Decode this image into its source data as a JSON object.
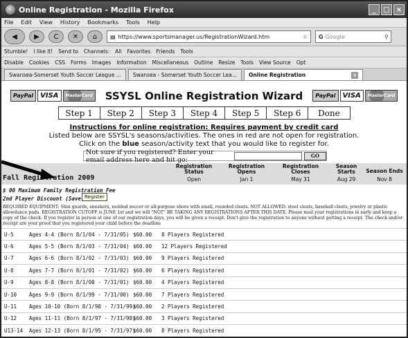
{
  "window": {
    "title": "Online Registration - Mozilla Firefox"
  },
  "menu": [
    "File",
    "Edit",
    "View",
    "History",
    "Bookmarks",
    "Tools",
    "Help"
  ],
  "nav": {
    "url": "https://www.sportsmanager.us/RegistrationWizard.htm",
    "search_placeholder": "Google"
  },
  "toolbar1": [
    "Stumble!",
    "I like it!",
    "Send to",
    "Channels:",
    "All",
    "Favorites",
    "Friends",
    "Tools"
  ],
  "toolbar2": [
    "Disable",
    "Cookies",
    "CSS",
    "Forms",
    "Images",
    "Information",
    "Miscellaneous",
    "Outline",
    "Resize",
    "Tools",
    "View Source",
    "Opt"
  ],
  "tabs": [
    {
      "label": "Swansea-Somerset Youth Soccer League ..."
    },
    {
      "label": "Swansea - Somerset Youth Soccer Lea..."
    },
    {
      "label": "Online Registration"
    }
  ],
  "page": {
    "payments": [
      "PayPal",
      "VISA",
      "MasterCard"
    ],
    "title": "SSYSL Online Registration Wizard",
    "steps": [
      "Step 1",
      "Step 2",
      "Step 3",
      "Step 4",
      "Step 5",
      "Step 6",
      "Done"
    ],
    "instr_heading": "Instructions for online registration: Requires payment by credit card",
    "instr_line2": "Listed below are SSYSL's seasons/activities. The ones in red are not open for registration.",
    "instr_line3_a": "Click on the ",
    "instr_line3_b": "blue",
    "instr_line3_c": " season/activity text that you would like to register for.",
    "email_prompt": "Not sure if you registered? Enter your email address here and hit go:",
    "go": "GO",
    "season": {
      "name": "Fall Registration 2009",
      "col_status": "Registration Status",
      "col_opens": "Registration Opens",
      "col_closes": "Registration Closes",
      "col_starts": "Season Starts",
      "col_ends": "Season Ends",
      "status": "Open",
      "opens": "Jan 1",
      "closes": "May 31",
      "starts": "Aug 29",
      "ends": "Nov 8"
    },
    "fee1": "$ 00 Maximum Family Registration Fee",
    "fee2": "2nd Player Discount (Save $20.00)",
    "tooltip": "Register",
    "equipment": "REQUIRED EQUIPMENT: Shin guards, sneakers, molded soccer or all-purpose shoes with small, rounded cleats. NOT ALLOWED: steel cleats, baseball cleats, jewelry or plastic allowdance pads. REGISTRATION CUTOFF is JUNE 1st and we will \"NOT\" BE TAKING ANY REGISTRATIONS AFTER THIS DATE. Please mail your registrations in early and keep a copy of the check. If you register in person at one of our registration days, you will be given a receipt. Don't give the registration to anyone without getting a receipt. The check and/or receipt are your proof that you registered your child before the deadline",
    "divisions": [
      {
        "div": "U-5",
        "ages": "Ages 4-4 (Born 8/1/04 - 7/31/05)",
        "fee": "$60.00",
        "count": "8 Players Registered"
      },
      {
        "div": "U-6",
        "ages": "Ages 5-5 (Born 8/1/03 - 7/31/04)",
        "fee": "$60.00",
        "count": "12 Players Registered"
      },
      {
        "div": "U-7",
        "ages": "Ages 6-6 (Born 8/1/02 - 7/31/03)",
        "fee": "$60.00",
        "count": "9 Players Registered"
      },
      {
        "div": "U-8",
        "ages": "Ages 7-7 (Born 8/1/01 - 7/31/02)",
        "fee": "$60.00",
        "count": "6 Players Registered"
      },
      {
        "div": "U-9",
        "ages": "Ages 8-8 (Born 8/1/00 - 7/31/01)",
        "fee": "$60.00",
        "count": "4 Players Registered"
      },
      {
        "div": "U-10",
        "ages": "Ages 9-9 (Born 8/1/99 - 7/31/00)",
        "fee": "$60.00",
        "count": "7 Players Registered"
      },
      {
        "div": "U-11",
        "ages": "Ages 10-10 (Born 8/1/98 - 7/31/99)",
        "fee": "$60.00",
        "count": "2 Players Registered"
      },
      {
        "div": "U-12",
        "ages": "Ages 11-11 (Born 8/1/97 - 7/31/98)",
        "fee": "$60.00",
        "count": "3 Players Registered"
      },
      {
        "div": "U13-14",
        "ages": "Ages 12-13 (Born 8/1/95 - 7/31/97)",
        "fee": "$60.00",
        "count": "8 Players Registered"
      }
    ]
  }
}
